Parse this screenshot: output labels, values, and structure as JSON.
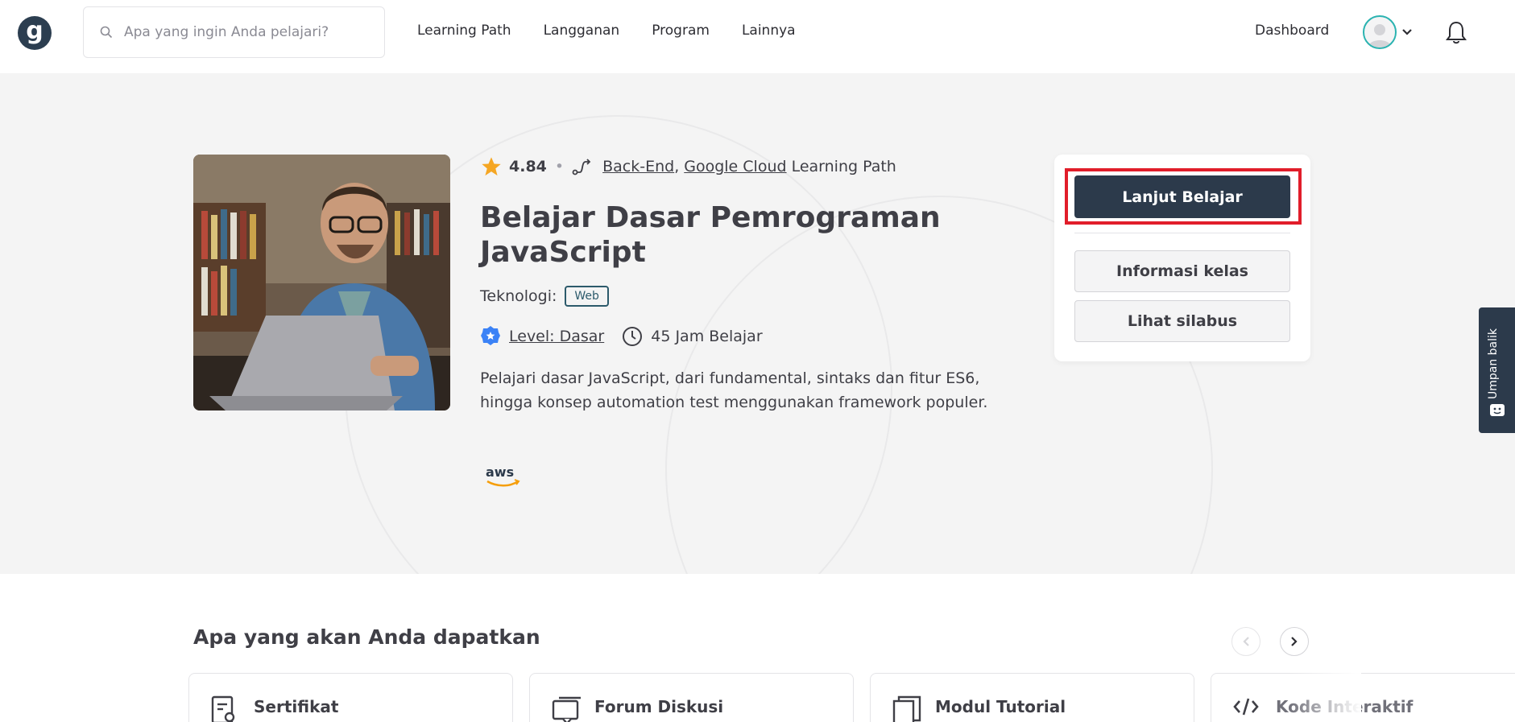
{
  "header": {
    "logo_letter": "g",
    "search_placeholder": "Apa yang ingin Anda pelajari?",
    "nav": [
      "Learning Path",
      "Langganan",
      "Program",
      "Lainnya"
    ],
    "dashboard_label": "Dashboard",
    "icons": {
      "search": "search-icon",
      "avatar": "user-avatar",
      "chevron": "chevron-down-icon",
      "bell": "bell-icon"
    }
  },
  "course": {
    "rating": "4.84",
    "learning_path_links": [
      "Back-End",
      "Google Cloud"
    ],
    "learning_path_separator": ",",
    "learning_path_suffix": "Learning Path",
    "title": "Belajar Dasar Pemrograman JavaScript",
    "technology_label": "Teknologi:",
    "technology_badge": "Web",
    "level": "Level: Dasar",
    "duration": "45 Jam Belajar",
    "description": "Pelajari dasar JavaScript, dari fundamental, sintaks dan fitur ES6, hingga konsep automation test menggunakan framework populer.",
    "partner_logo": "aws"
  },
  "actions": {
    "primary": "Lanjut Belajar",
    "info": "Informasi kelas",
    "syllabus": "Lihat silabus"
  },
  "feedback": {
    "label": "Umpan balik"
  },
  "benefits": {
    "title": "Apa yang akan Anda dapatkan",
    "items": [
      {
        "label": "Sertifikat",
        "icon": "certificate-icon"
      },
      {
        "label": "Forum Diskusi",
        "icon": "forum-icon"
      },
      {
        "label": "Modul Tutorial",
        "icon": "module-icon"
      },
      {
        "label": "Kode Interaktif",
        "icon": "code-icon"
      }
    ]
  },
  "colors": {
    "primary_dark": "#2c3a4b",
    "highlight": "#e11d2a",
    "star": "#f5a623",
    "accent_teal": "#2bb3b1"
  }
}
